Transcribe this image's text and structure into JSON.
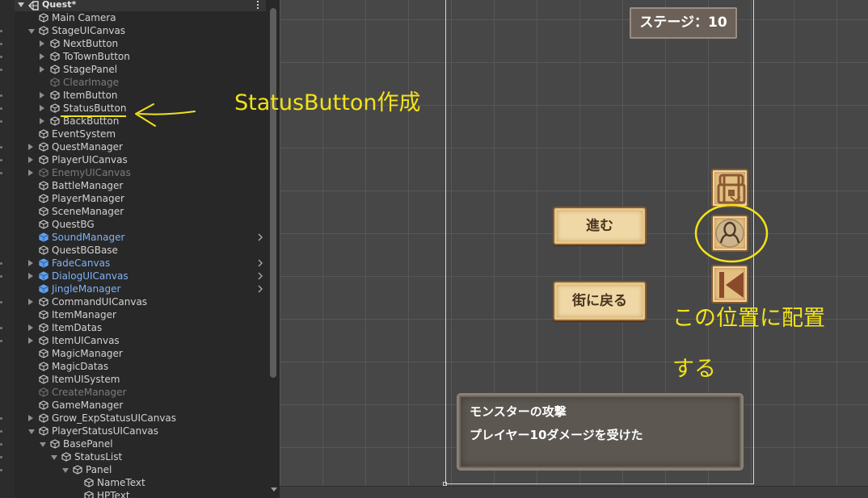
{
  "hierarchy": {
    "scene_name": "Quest*",
    "items": [
      {
        "label": "Main Camera",
        "depth": 1,
        "arrow": "",
        "state": "normal"
      },
      {
        "label": "StageUICanvas",
        "depth": 1,
        "arrow": "down",
        "state": "normal"
      },
      {
        "label": "NextButton",
        "depth": 2,
        "arrow": "right",
        "state": "normal"
      },
      {
        "label": "ToTownButton",
        "depth": 2,
        "arrow": "right",
        "state": "normal"
      },
      {
        "label": "StagePanel",
        "depth": 2,
        "arrow": "right",
        "state": "normal"
      },
      {
        "label": "ClearImage",
        "depth": 2,
        "arrow": "",
        "state": "disabled"
      },
      {
        "label": "ItemButton",
        "depth": 2,
        "arrow": "right",
        "state": "normal"
      },
      {
        "label": "StatusButton",
        "depth": 2,
        "arrow": "right",
        "state": "normal"
      },
      {
        "label": "BackButton",
        "depth": 2,
        "arrow": "right",
        "state": "normal"
      },
      {
        "label": "EventSystem",
        "depth": 1,
        "arrow": "",
        "state": "normal"
      },
      {
        "label": "QuestManager",
        "depth": 1,
        "arrow": "right",
        "state": "normal"
      },
      {
        "label": "PlayerUICanvas",
        "depth": 1,
        "arrow": "right",
        "state": "normal"
      },
      {
        "label": "EnemyUICanvas",
        "depth": 1,
        "arrow": "right",
        "state": "disabled"
      },
      {
        "label": "BattleManager",
        "depth": 1,
        "arrow": "",
        "state": "normal"
      },
      {
        "label": "PlayerManager",
        "depth": 1,
        "arrow": "",
        "state": "normal"
      },
      {
        "label": "SceneManager",
        "depth": 1,
        "arrow": "",
        "state": "normal"
      },
      {
        "label": "QuestBG",
        "depth": 1,
        "arrow": "",
        "state": "normal"
      },
      {
        "label": "SoundManager",
        "depth": 1,
        "arrow": "",
        "state": "prefab",
        "chevron": true
      },
      {
        "label": "QuestBGBase",
        "depth": 1,
        "arrow": "",
        "state": "normal"
      },
      {
        "label": "FadeCanvas",
        "depth": 1,
        "arrow": "right",
        "state": "prefab",
        "chevron": true
      },
      {
        "label": "DialogUICanvas",
        "depth": 1,
        "arrow": "right",
        "state": "prefab",
        "chevron": true
      },
      {
        "label": "JingleManager",
        "depth": 1,
        "arrow": "",
        "state": "prefab",
        "chevron": true
      },
      {
        "label": "CommandUICanvas",
        "depth": 1,
        "arrow": "right",
        "state": "normal"
      },
      {
        "label": "ItemManager",
        "depth": 1,
        "arrow": "",
        "state": "normal"
      },
      {
        "label": "ItemDatas",
        "depth": 1,
        "arrow": "right",
        "state": "normal"
      },
      {
        "label": "ItemUICanvas",
        "depth": 1,
        "arrow": "right",
        "state": "normal"
      },
      {
        "label": "MagicManager",
        "depth": 1,
        "arrow": "",
        "state": "normal"
      },
      {
        "label": "MagicDatas",
        "depth": 1,
        "arrow": "",
        "state": "normal"
      },
      {
        "label": "ItemUISystem",
        "depth": 1,
        "arrow": "",
        "state": "normal"
      },
      {
        "label": "CreateManager",
        "depth": 1,
        "arrow": "",
        "state": "disabled"
      },
      {
        "label": "GameManager",
        "depth": 1,
        "arrow": "",
        "state": "normal"
      },
      {
        "label": "Grow_ExpStatusUICanvas",
        "depth": 1,
        "arrow": "right",
        "state": "normal"
      },
      {
        "label": "PlayerStatusUICanvas",
        "depth": 1,
        "arrow": "down",
        "state": "normal"
      },
      {
        "label": "BasePanel",
        "depth": 2,
        "arrow": "down",
        "state": "normal"
      },
      {
        "label": "StatusList",
        "depth": 3,
        "arrow": "down",
        "state": "normal"
      },
      {
        "label": "Panel",
        "depth": 4,
        "arrow": "down",
        "state": "normal"
      },
      {
        "label": "NameText",
        "depth": 5,
        "arrow": "",
        "state": "normal"
      },
      {
        "label": "HPText",
        "depth": 5,
        "arrow": "",
        "state": "normal"
      }
    ]
  },
  "scene": {
    "stage_label": "ステージ：10",
    "next_button_label": "進む",
    "town_button_label": "街に戻る",
    "message_lines": [
      "モンスターの攻撃",
      "プレイヤー10ダメージを受けた"
    ],
    "icons": [
      "treasure-chest-icon",
      "person-silhouette-icon",
      "skip-back-icon"
    ]
  },
  "annotations": {
    "status_note": "StatusButton作成",
    "placement_line_1": "この位置に配置",
    "placement_line_2": "する",
    "color": "#f2e21a"
  },
  "colors": {
    "prefab_text": "#7eb2f7",
    "disabled_text": "#7c7c7c",
    "normal_text": "#d2d2d2",
    "scene_bg": "#474747",
    "annotation": "#f2e21a"
  }
}
